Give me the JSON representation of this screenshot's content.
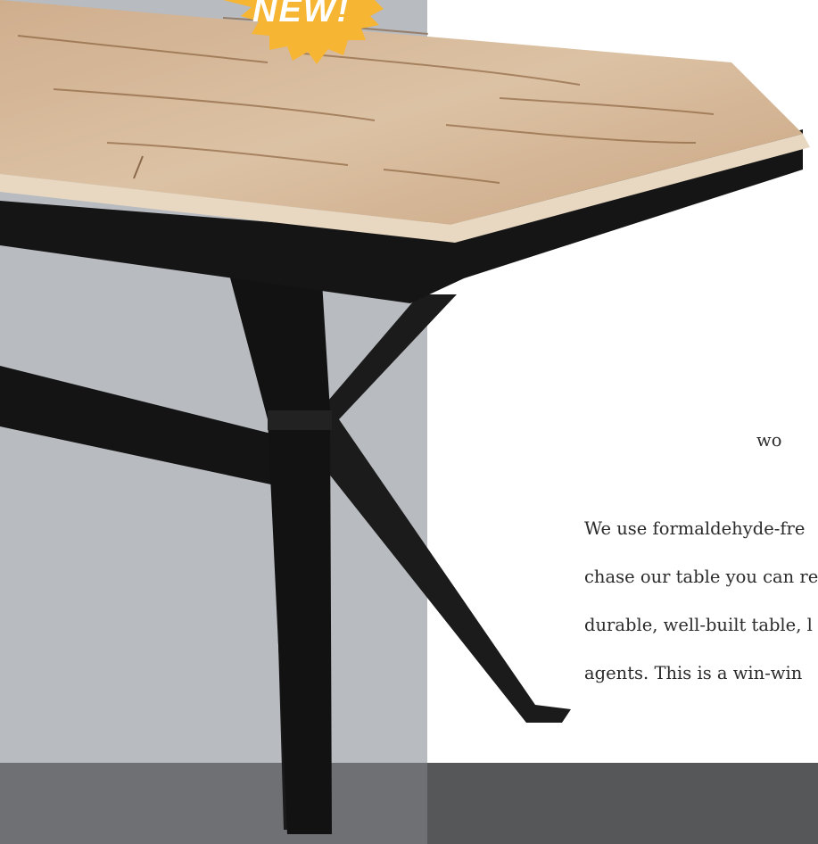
{
  "badge": {
    "label": "NEW!",
    "color": "#f6b533"
  },
  "colors": {
    "panel": "#b8bbbf",
    "band_left": "#6f7073",
    "band_right": "#565759",
    "frame": "#151515",
    "wood": "#d8bd9e"
  },
  "text": {
    "fragment_top": "wo",
    "lines": [
      "We use formaldehyde-fre",
      "chase our table you can re",
      "durable, well-built table, l",
      "agents. This is a win-win"
    ]
  }
}
